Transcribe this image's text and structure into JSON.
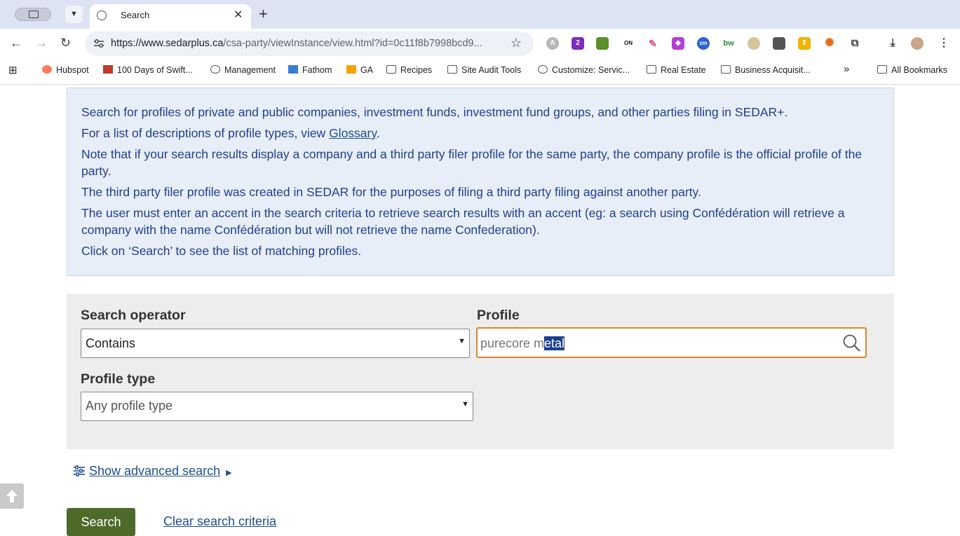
{
  "browser": {
    "tab_title": "Search",
    "url_host": "https://www.sedarplus.ca",
    "url_path": "/csa-party/viewInstance/view.html?id=0c11f8b7998bcd9...",
    "extension_badge": "2",
    "on_badge": "ON"
  },
  "bookmarks": {
    "items": [
      "Hubspot",
      "100 Days of Swift...",
      "Management",
      "Fathom",
      "GA",
      "Recipes",
      "Site Audit Tools",
      "Customize: Servic...",
      "Real Estate",
      "Business Acquisit..."
    ],
    "more": "»",
    "all": "All Bookmarks"
  },
  "info": {
    "line1": "Search for profiles of private and public companies, investment funds, investment fund groups, and other parties filing in SEDAR+.",
    "line2_prefix": "For a list of descriptions of profile types, view ",
    "line2_link": "Glossary",
    "line2_suffix": ".",
    "line3": "Note that if your search results display a company and a third party filer profile for the same party, the company profile is the official profile of the party.",
    "line4": "The third party filer profile was created in SEDAR for the purposes of filing a third party filing against another party.",
    "line5": "The user must enter an accent in the search criteria to retrieve search results with an accent (eg: a search using Confédération will retrieve a company with the name Confédération but will not retrieve the name Confederation).",
    "line6": "Click on ‘Search’ to see the list of matching profiles."
  },
  "form": {
    "operator_label": "Search operator",
    "operator_value": "Contains",
    "profile_label": "Profile",
    "profile_value_unselected": "purecore m",
    "profile_value_selected": "etal",
    "profile_type_label": "Profile type",
    "profile_type_value": "Any profile type",
    "advanced_link": "Show advanced search",
    "search_button": "Search",
    "clear_link": "Clear search criteria"
  },
  "colors": {
    "accent_text": "#1f3f8f",
    "focus_border": "#d4892a",
    "search_button": "#4e6a2a"
  }
}
